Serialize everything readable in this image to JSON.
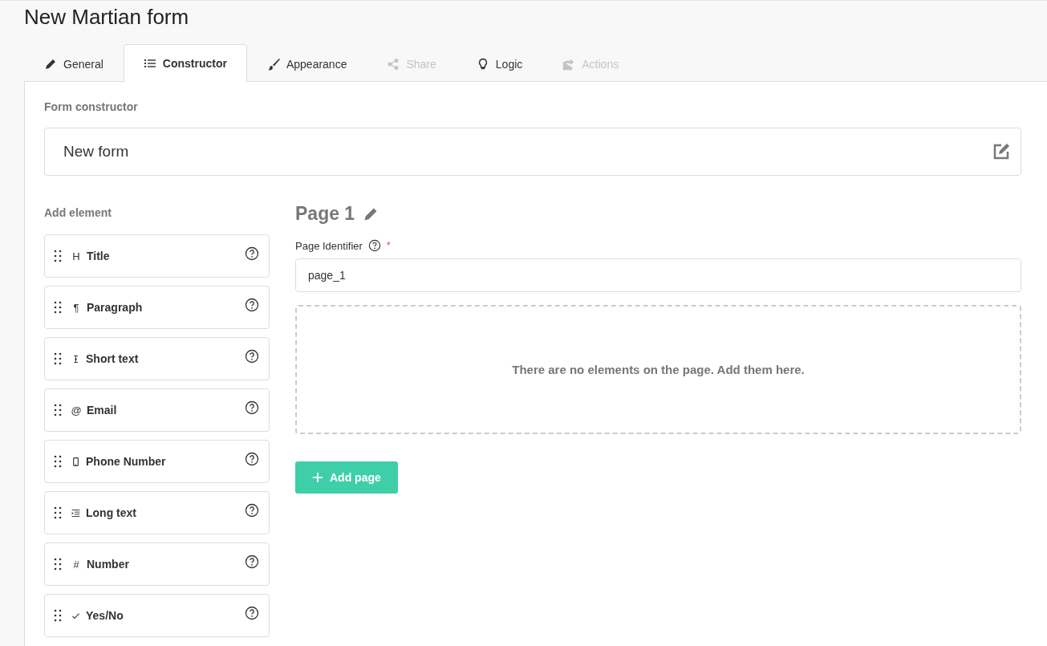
{
  "title": "New Martian form",
  "tabs": [
    {
      "label": "General",
      "kind": "pencil",
      "selected": false,
      "disabled": false
    },
    {
      "label": "Constructor",
      "kind": "list",
      "selected": true,
      "disabled": false
    },
    {
      "label": "Appearance",
      "kind": "brush",
      "selected": false,
      "disabled": false
    },
    {
      "label": "Share",
      "kind": "share",
      "selected": false,
      "disabled": true
    },
    {
      "label": "Logic",
      "kind": "bulb",
      "selected": false,
      "disabled": false
    },
    {
      "label": "Actions",
      "kind": "export",
      "selected": false,
      "disabled": true
    }
  ],
  "section_label": "Form constructor",
  "form_name": "New form",
  "add_element": {
    "heading": "Add element",
    "items": [
      {
        "label": "Title",
        "kind": "glyph",
        "glyph": "H"
      },
      {
        "label": "Paragraph",
        "kind": "glyph",
        "glyph": "¶"
      },
      {
        "label": "Short text",
        "kind": "cursor"
      },
      {
        "label": "Email",
        "kind": "glyph",
        "glyph": "@"
      },
      {
        "label": "Phone Number",
        "kind": "phone"
      },
      {
        "label": "Long text",
        "kind": "indent"
      },
      {
        "label": "Number",
        "kind": "glyph",
        "glyph": "#"
      },
      {
        "label": "Yes/No",
        "kind": "check"
      }
    ]
  },
  "page": {
    "title": "Page 1",
    "identifier_label": "Page Identifier",
    "required_mark": "*",
    "identifier_value": "page_1",
    "empty_message": "There are no elements on the page. Add them here.",
    "add_page_button": "Add page"
  }
}
